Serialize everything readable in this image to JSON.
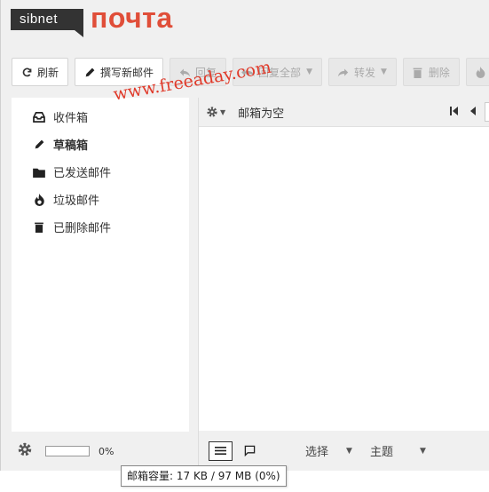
{
  "logo": {
    "brand": "sibnet",
    "product": "почта"
  },
  "toolbar": {
    "refresh": "刷新",
    "compose": "撰写新邮件",
    "reply": "回复",
    "reply_all": "回复全部",
    "forward": "转发",
    "delete": "删除",
    "spam": "垃"
  },
  "folders": [
    {
      "label": "收件箱",
      "icon": "inbox-icon"
    },
    {
      "label": "草稿箱",
      "icon": "pencil-icon"
    },
    {
      "label": "已发送邮件",
      "icon": "folder-icon"
    },
    {
      "label": "垃圾邮件",
      "icon": "flame-icon"
    },
    {
      "label": "已删除邮件",
      "icon": "trash-icon"
    }
  ],
  "quota": {
    "percent_label": "0%",
    "fraction": 0.0
  },
  "main": {
    "empty_label": "邮箱为空"
  },
  "footer": {
    "select_label": "选择",
    "thread_label": "主题"
  },
  "watermark": "www.freeaday.com",
  "tooltip": "邮箱容量: 17 KB / 97 MB (0%)",
  "colors": {
    "brand": "#e04e39",
    "logo_bg": "#333333",
    "watermark": "#e03a2a"
  }
}
